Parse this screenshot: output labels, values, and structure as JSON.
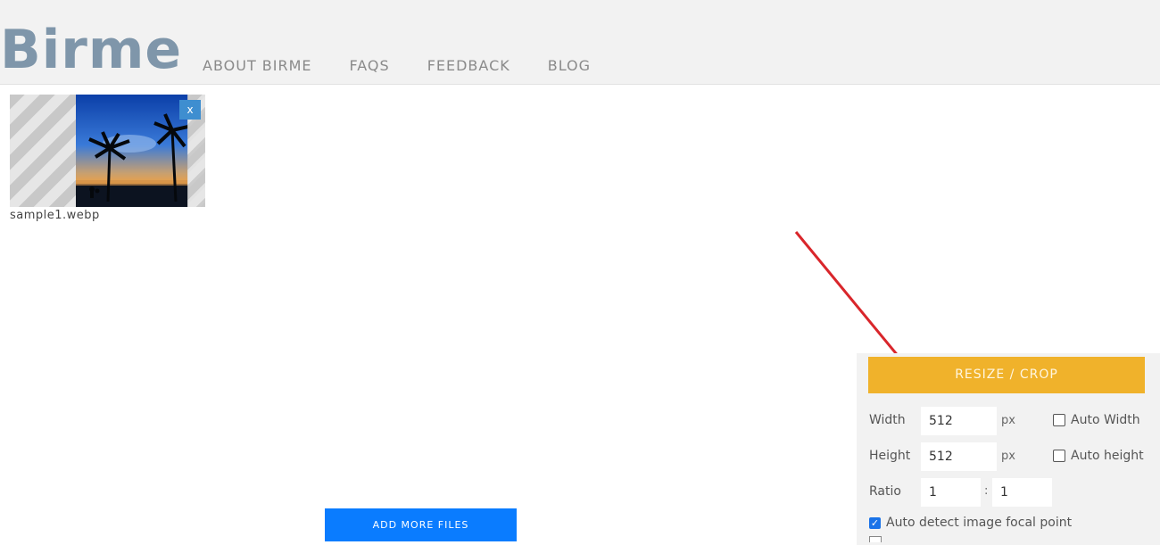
{
  "header": {
    "logo_text": "Birme",
    "nav": [
      "ABOUT BIRME",
      "FAQS",
      "FEEDBACK",
      "BLOG"
    ]
  },
  "files": [
    {
      "filename": "sample1.webp",
      "remove_label": "x"
    }
  ],
  "add_more_label": "ADD MORE FILES",
  "panel": {
    "resize_label": "RESIZE / CROP",
    "width_label": "Width",
    "width_value": "512",
    "height_label": "Height",
    "height_value": "512",
    "unit": "px",
    "auto_width_label": "Auto Width",
    "auto_height_label": "Auto height",
    "ratio_label": "Ratio",
    "ratio_a": "1",
    "ratio_sep": ":",
    "ratio_b": "1",
    "focal_label": "Auto detect image focal point",
    "focal_checked": true,
    "auto_width_checked": false,
    "auto_height_checked": false
  },
  "colors": {
    "header_bg": "#f2f2f2",
    "logo": "#7f96aa",
    "resize_button": "#f0b22b",
    "add_more_button": "#0a7cff",
    "annotation_arrow": "#d9262b"
  }
}
